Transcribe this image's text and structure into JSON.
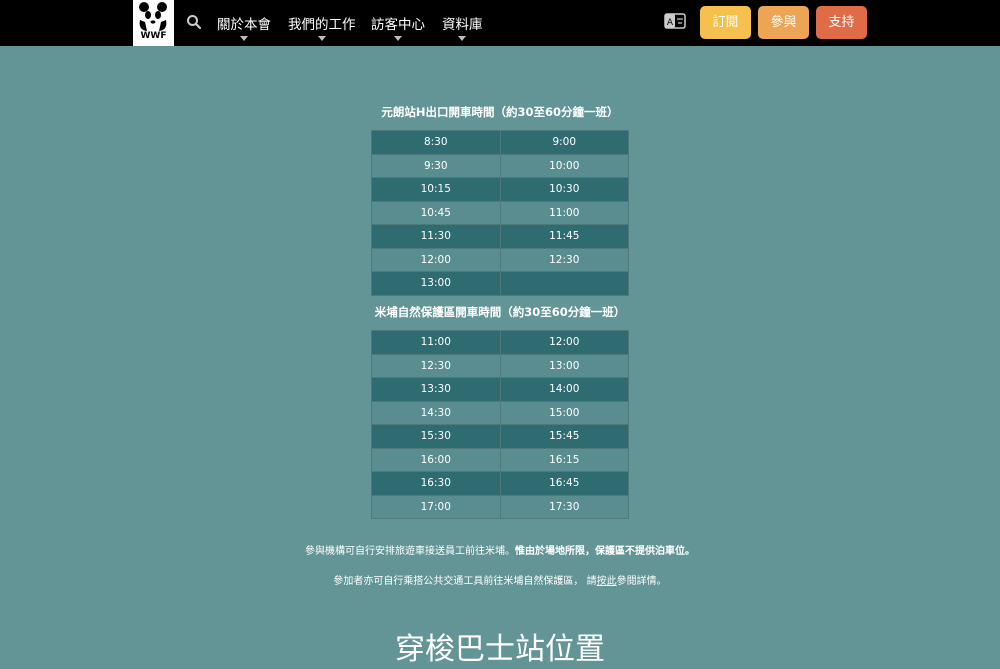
{
  "header": {
    "logo_text": "WWF",
    "nav": [
      {
        "label": "關於本會"
      },
      {
        "label": "我們的工作"
      },
      {
        "label": "訪客中心"
      },
      {
        "label": "資料庫"
      }
    ],
    "buttons": {
      "subscribe": "訂閱",
      "join": "參與",
      "support": "支持"
    },
    "colors": {
      "subscribe": "#f6c04f",
      "join": "#eea455",
      "support": "#df6c47"
    }
  },
  "schedule1": {
    "title": "元朗站H出口開車時間（約30至60分鐘一班）",
    "rows": [
      [
        "8:30",
        "9:00"
      ],
      [
        "9:30",
        "10:00"
      ],
      [
        "10:15",
        "10:30"
      ],
      [
        "10:45",
        "11:00"
      ],
      [
        "11:30",
        "11:45"
      ],
      [
        "12:00",
        "12:30"
      ],
      [
        "13:00",
        ""
      ]
    ]
  },
  "schedule2": {
    "title": "米埔自然保護區開車時間（約30至60分鐘一班）",
    "rows": [
      [
        "11:00",
        "12:00"
      ],
      [
        "12:30",
        "13:00"
      ],
      [
        "13:30",
        "14:00"
      ],
      [
        "14:30",
        "15:00"
      ],
      [
        "15:30",
        "15:45"
      ],
      [
        "16:00",
        "16:15"
      ],
      [
        "16:30",
        "16:45"
      ],
      [
        "17:00",
        "17:30"
      ]
    ]
  },
  "notes": {
    "line1_pre": "參與機構可自行安排旅遊車接送員工前往米埔。",
    "line1_bold": "惟由於場地所限，保護區不提供泊車位。",
    "line2_pre": "參加者亦可自行乘搭公共交通工具前往米埔自然保護區， 請",
    "line2_link": "按此",
    "line2_post": "參閱詳情。"
  },
  "section_heading": "穿梭巴士站位置"
}
